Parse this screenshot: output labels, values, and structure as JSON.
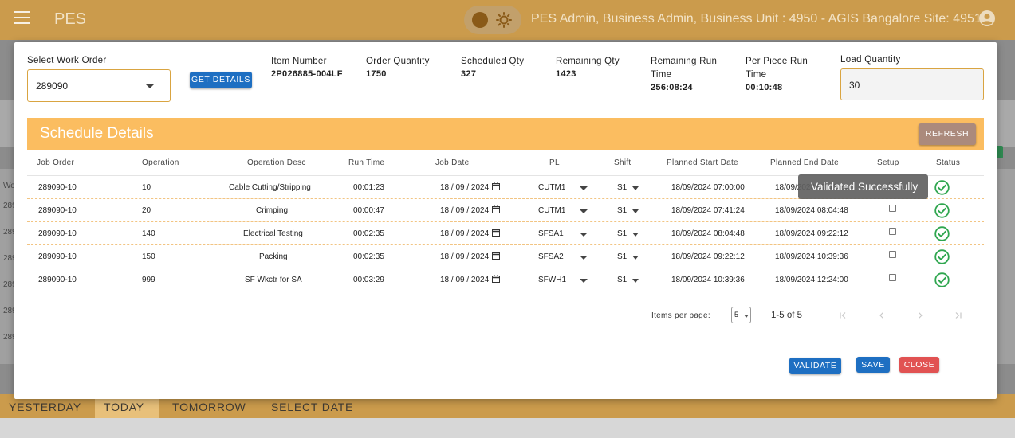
{
  "app": {
    "title": "PES",
    "user_info": "PES Admin, Business Admin, Business Unit : 4950 - AGIS Bangalore Site: 49510"
  },
  "background": {
    "row_labels": [
      "Wo",
      "289",
      "289",
      "289",
      "289",
      "289",
      "289"
    ]
  },
  "day_tabs": [
    "YESTERDAY",
    "TODAY",
    "TOMORROW",
    "SELECT DATE"
  ],
  "dialog": {
    "select_label": "Select Work Order",
    "work_order": "289090",
    "get_details_label": "GET DETAILS",
    "info": [
      {
        "label": "Item Number",
        "value": "2P026885-004LF"
      },
      {
        "label": "Order Quantity",
        "value": "1750"
      },
      {
        "label": "Scheduled Qty",
        "value": "327"
      },
      {
        "label": "Remaining Qty",
        "value": "1423"
      },
      {
        "label": "Remaining Run Time",
        "value": "256:08:24"
      },
      {
        "label": "Per Piece Run Time",
        "value": "00:10:48"
      }
    ],
    "load_quantity_label": "Load Quantity",
    "load_quantity": "30",
    "schedule_title": "Schedule Details",
    "refresh_label": "REFRESH",
    "columns": [
      "Job Order",
      "Operation",
      "Operation Desc",
      "Run Time",
      "Job Date",
      "PL",
      "Shift",
      "Planned Start Date",
      "Planned End Date",
      "Setup",
      "Status"
    ],
    "rows": [
      {
        "job_order": "289090-10",
        "operation": "10",
        "desc": "Cable Cutting/Stripping",
        "run_time": "00:01:23",
        "job_date": "18 / 09 / 2024",
        "pl": "CUTM1",
        "shift": "S1",
        "start": "18/09/2024 07:00:00",
        "end": "18/09/2024 07:41:24",
        "setup": false,
        "status": "validated"
      },
      {
        "job_order": "289090-10",
        "operation": "20",
        "desc": "Crimping",
        "run_time": "00:00:47",
        "job_date": "18 / 09 / 2024",
        "pl": "CUTM1",
        "shift": "S1",
        "start": "18/09/2024 07:41:24",
        "end": "18/09/2024 08:04:48",
        "setup": false,
        "status": "validated"
      },
      {
        "job_order": "289090-10",
        "operation": "140",
        "desc": "Electrical Testing",
        "run_time": "00:02:35",
        "job_date": "18 / 09 / 2024",
        "pl": "SFSA1",
        "shift": "S1",
        "start": "18/09/2024 08:04:48",
        "end": "18/09/2024 09:22:12",
        "setup": false,
        "status": "validated"
      },
      {
        "job_order": "289090-10",
        "operation": "150",
        "desc": "Packing",
        "run_time": "00:02:35",
        "job_date": "18 / 09 / 2024",
        "pl": "SFSA2",
        "shift": "S1",
        "start": "18/09/2024 09:22:12",
        "end": "18/09/2024 10:39:36",
        "setup": false,
        "status": "validated"
      },
      {
        "job_order": "289090-10",
        "operation": "999",
        "desc": "SF Wkctr for SA",
        "run_time": "00:03:29",
        "job_date": "18 / 09 / 2024",
        "pl": "SFWH1",
        "shift": "S1",
        "start": "18/09/2024 10:39:36",
        "end": "18/09/2024 12:24:00",
        "setup": false,
        "status": "validated"
      }
    ],
    "tooltip": "Validated Successfully",
    "paginator": {
      "items_per_page_label": "Items per page:",
      "page_size": "5",
      "range": "1-5 of 5"
    },
    "validate_label": "VALIDATE",
    "save_label": "SAVE",
    "close_label": "CLOSE"
  },
  "colors": {
    "brand_orange": "#fbbd60",
    "primary_blue": "#1e6fc2",
    "close_red": "#e15252",
    "status_green": "#2fa64f"
  }
}
